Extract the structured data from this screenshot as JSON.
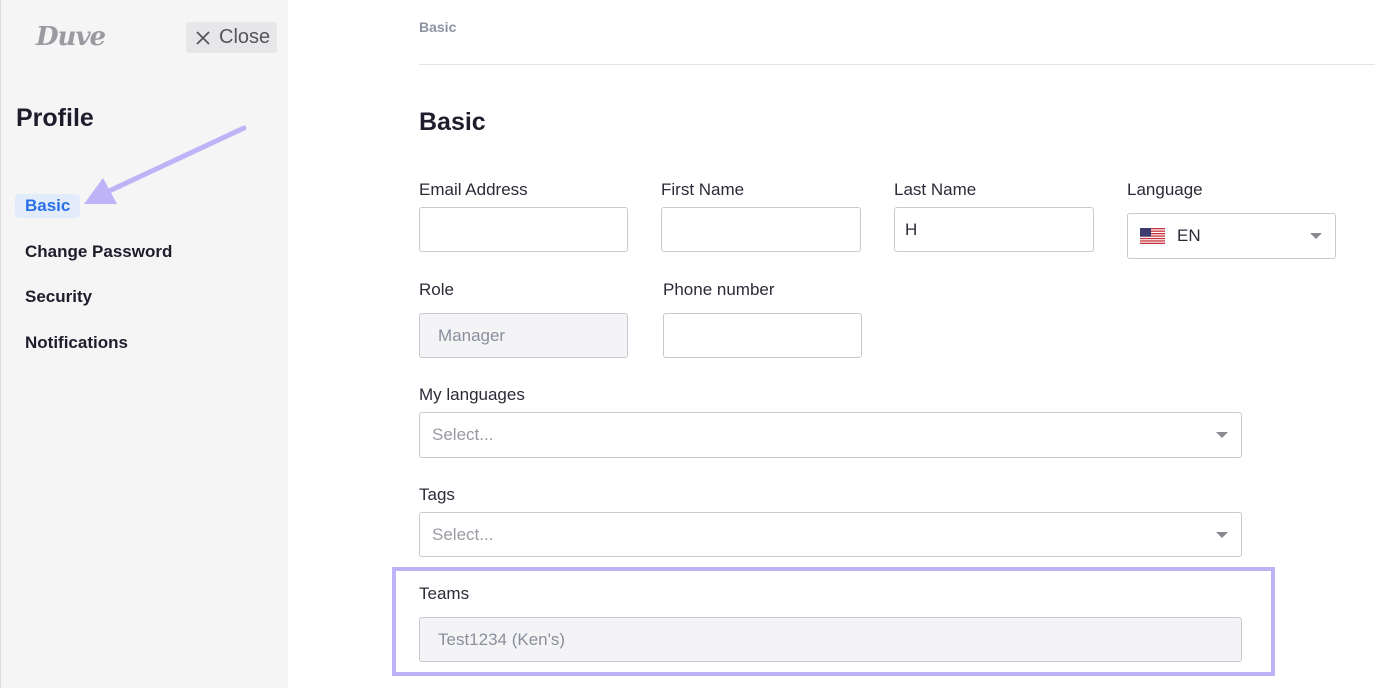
{
  "sidebar": {
    "logo": "Duve",
    "close_label": "Close",
    "title": "Profile",
    "items": [
      {
        "label": "Basic",
        "active": true
      },
      {
        "label": "Change Password"
      },
      {
        "label": "Security"
      },
      {
        "label": "Notifications"
      }
    ]
  },
  "main": {
    "breadcrumb": "Basic",
    "section_title": "Basic",
    "fields": {
      "email": {
        "label": "Email Address",
        "value": ""
      },
      "first_name": {
        "label": "First Name",
        "value": ""
      },
      "last_name": {
        "label": "Last Name",
        "value": "H"
      },
      "language": {
        "label": "Language",
        "value": "EN",
        "flag_icon": "us-flag-icon"
      },
      "role": {
        "label": "Role",
        "value": "Manager"
      },
      "phone": {
        "label": "Phone number",
        "value": ""
      },
      "my_languages": {
        "label": "My languages",
        "placeholder": "Select..."
      },
      "tags": {
        "label": "Tags",
        "placeholder": "Select..."
      },
      "teams": {
        "label": "Teams",
        "value": "Test1234 (Ken's)"
      }
    }
  },
  "colors": {
    "accent": "#2a71e5",
    "highlight": "#bfb3f7",
    "sidebar_bg": "#f5f5f6"
  }
}
